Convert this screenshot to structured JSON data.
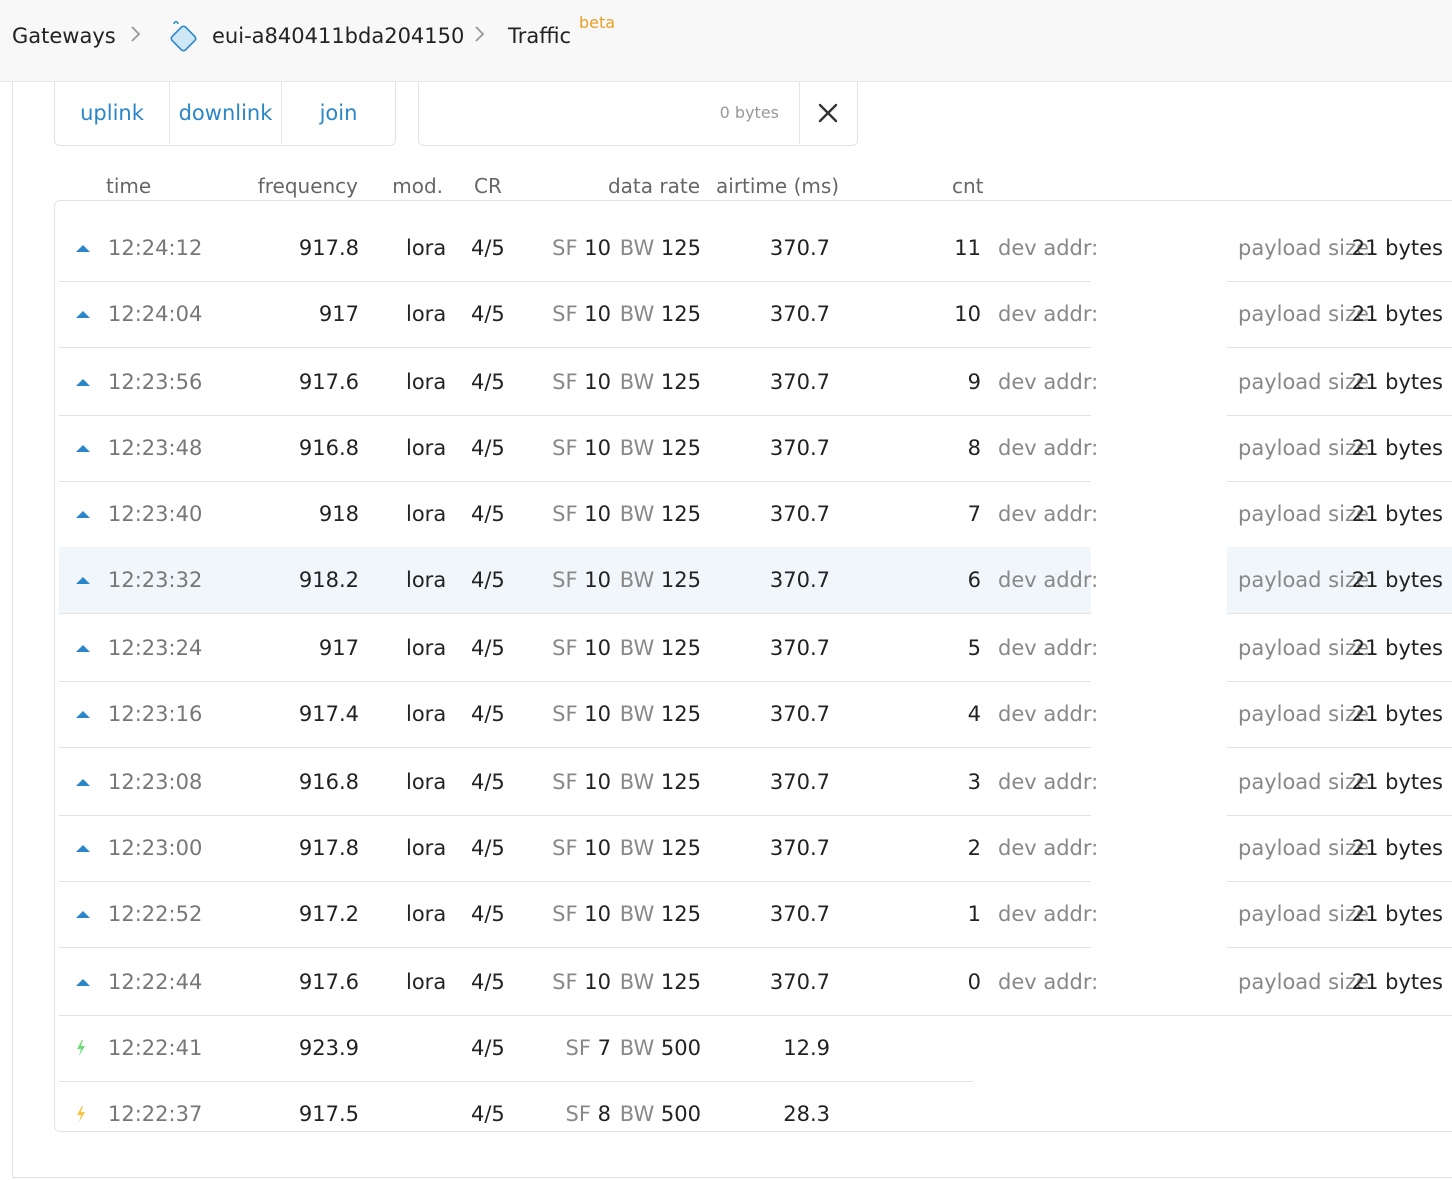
{
  "breadcrumb": {
    "gateways": "Gateways",
    "gateway_id": "eui-a840411bda204150",
    "traffic": "Traffic",
    "beta": "beta",
    "separator": ">"
  },
  "filters": {
    "uplink": "uplink",
    "downlink": "downlink",
    "join": "join"
  },
  "bytes_filter": {
    "value": "0 bytes",
    "clear_icon": "close-icon"
  },
  "table": {
    "columns": {
      "time": "time",
      "frequency": "frequency",
      "mod": "mod.",
      "cr": "CR",
      "data_rate": "data rate",
      "airtime": "airtime (ms)",
      "cnt": "cnt"
    },
    "labels": {
      "sf": "SF",
      "bw": "BW",
      "dev_addr": "dev addr:",
      "payload_size": "payload size:"
    },
    "rows": [
      {
        "type": "uplink",
        "time": "12:24:12",
        "frequency": "917.8",
        "mod": "lora",
        "cr": "4/5",
        "sf": "10",
        "bw": "125",
        "airtime": "370.7",
        "cnt": "11",
        "payload": "21 bytes"
      },
      {
        "type": "uplink",
        "time": "12:24:04",
        "frequency": "917",
        "mod": "lora",
        "cr": "4/5",
        "sf": "10",
        "bw": "125",
        "airtime": "370.7",
        "cnt": "10",
        "payload": "21 bytes"
      },
      {
        "type": "uplink",
        "time": "12:23:56",
        "frequency": "917.6",
        "mod": "lora",
        "cr": "4/5",
        "sf": "10",
        "bw": "125",
        "airtime": "370.7",
        "cnt": "9",
        "payload": "21 bytes"
      },
      {
        "type": "uplink",
        "time": "12:23:48",
        "frequency": "916.8",
        "mod": "lora",
        "cr": "4/5",
        "sf": "10",
        "bw": "125",
        "airtime": "370.7",
        "cnt": "8",
        "payload": "21 bytes"
      },
      {
        "type": "uplink",
        "time": "12:23:40",
        "frequency": "918",
        "mod": "lora",
        "cr": "4/5",
        "sf": "10",
        "bw": "125",
        "airtime": "370.7",
        "cnt": "7",
        "payload": "21 bytes"
      },
      {
        "type": "uplink",
        "time": "12:23:32",
        "frequency": "918.2",
        "mod": "lora",
        "cr": "4/5",
        "sf": "10",
        "bw": "125",
        "airtime": "370.7",
        "cnt": "6",
        "payload": "21 bytes",
        "highlighted": true
      },
      {
        "type": "uplink",
        "time": "12:23:24",
        "frequency": "917",
        "mod": "lora",
        "cr": "4/5",
        "sf": "10",
        "bw": "125",
        "airtime": "370.7",
        "cnt": "5",
        "payload": "21 bytes"
      },
      {
        "type": "uplink",
        "time": "12:23:16",
        "frequency": "917.4",
        "mod": "lora",
        "cr": "4/5",
        "sf": "10",
        "bw": "125",
        "airtime": "370.7",
        "cnt": "4",
        "payload": "21 bytes"
      },
      {
        "type": "uplink",
        "time": "12:23:08",
        "frequency": "916.8",
        "mod": "lora",
        "cr": "4/5",
        "sf": "10",
        "bw": "125",
        "airtime": "370.7",
        "cnt": "3",
        "payload": "21 bytes"
      },
      {
        "type": "uplink",
        "time": "12:23:00",
        "frequency": "917.8",
        "mod": "lora",
        "cr": "4/5",
        "sf": "10",
        "bw": "125",
        "airtime": "370.7",
        "cnt": "2",
        "payload": "21 bytes"
      },
      {
        "type": "uplink",
        "time": "12:22:52",
        "frequency": "917.2",
        "mod": "lora",
        "cr": "4/5",
        "sf": "10",
        "bw": "125",
        "airtime": "370.7",
        "cnt": "1",
        "payload": "21 bytes"
      },
      {
        "type": "uplink",
        "time": "12:22:44",
        "frequency": "917.6",
        "mod": "lora",
        "cr": "4/5",
        "sf": "10",
        "bw": "125",
        "airtime": "370.7",
        "cnt": "0",
        "payload": "21 bytes"
      },
      {
        "type": "activation-accept",
        "time": "12:22:41",
        "frequency": "923.9",
        "mod": "",
        "cr": "4/5",
        "sf": "7",
        "bw": "500",
        "airtime": "12.9",
        "cnt": "",
        "payload": ""
      },
      {
        "type": "activation-request",
        "time": "12:22:37",
        "frequency": "917.5",
        "mod": "",
        "cr": "4/5",
        "sf": "8",
        "bw": "500",
        "airtime": "28.3",
        "cnt": "",
        "payload": ""
      }
    ]
  },
  "colors": {
    "accent": "#2a86c9",
    "beta": "#e8a020",
    "uplink_icon": "#2a86c9",
    "activation_accept_icon": "#6fdc7a",
    "activation_request_icon": "#f5c545",
    "highlight_row": "#f0f6fa"
  }
}
